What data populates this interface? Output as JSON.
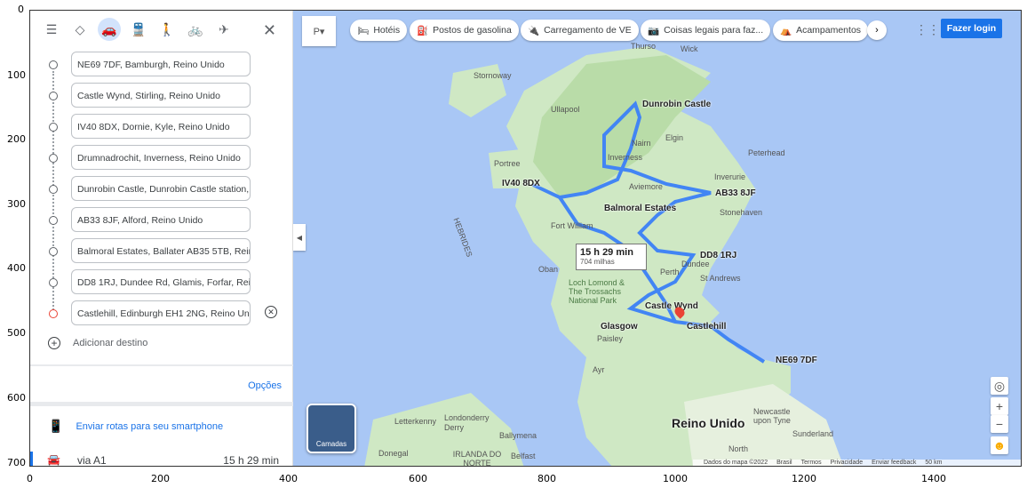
{
  "axes": {
    "x": [
      "0",
      "200",
      "400",
      "600",
      "800",
      "1000",
      "1200",
      "1400"
    ],
    "y": [
      "0",
      "100",
      "200",
      "300",
      "400",
      "500",
      "600",
      "700"
    ]
  },
  "panel": {
    "stops": [
      "NE69 7DF, Bamburgh, Reino Unido",
      "Castle Wynd, Stirling, Reino Unido",
      "IV40 8DX, Dornie, Kyle, Reino Unido",
      "Drumnadrochit, Inverness, Reino Unido",
      "Dunrobin Castle, Dunrobin Castle station,",
      "AB33 8JF, Alford, Reino Unido",
      "Balmoral Estates, Ballater AB35 5TB, Rein",
      "DD8 1RJ, Dundee Rd, Glamis, Forfar, Rein",
      "Castlehill, Edinburgh EH1 2NG, Reino Uni"
    ],
    "add_destination": "Adicionar destino",
    "options": "Opções",
    "send_to_phone": "Enviar rotas para seu smartphone",
    "route_name": "via A1",
    "route_time": "15 h 29 min"
  },
  "map": {
    "chips": [
      "Hotéis",
      "Postos de gasolina",
      "Carregamento de VE",
      "Coisas legais para faz...",
      "Acampamentos"
    ],
    "login": "Fazer login",
    "route_box": {
      "time": "15 h 29 min",
      "distance": "704 milhas"
    },
    "places": [
      "Dunrobin Castle",
      "IV40 8DX",
      "AB33 8JF",
      "Balmoral Estates",
      "DD8 1RJ",
      "Castle Wynd",
      "Castlehill",
      "NE69 7DF",
      "Glasgow",
      "Reino Unido"
    ],
    "minor_labels": [
      "Stornoway",
      "Ullapool",
      "Portree",
      "Nairn",
      "Elgin",
      "Peterhead",
      "Inverurie",
      "Aviemore",
      "Stonehaven",
      "Fort William",
      "Oban",
      "Dundee",
      "Perth",
      "St Andrews",
      "Loch Lomond & The Trossachs National Park",
      "Paisley",
      "Ayr",
      "Londonderry",
      "Derry",
      "Ballymena",
      "Belfast",
      "Letterkenny",
      "IRLANDA DO NORTE",
      "Donegal",
      "Newcastle upon Tyne",
      "Sunderland",
      "Wick",
      "Thurso",
      "HEBRIDES",
      "Inverness",
      "North"
    ],
    "layers": "Camadas",
    "footer": [
      "Dados do mapa ©2022",
      "Brasil",
      "Termos",
      "Privacidade",
      "Enviar feedback",
      "50 km"
    ]
  }
}
